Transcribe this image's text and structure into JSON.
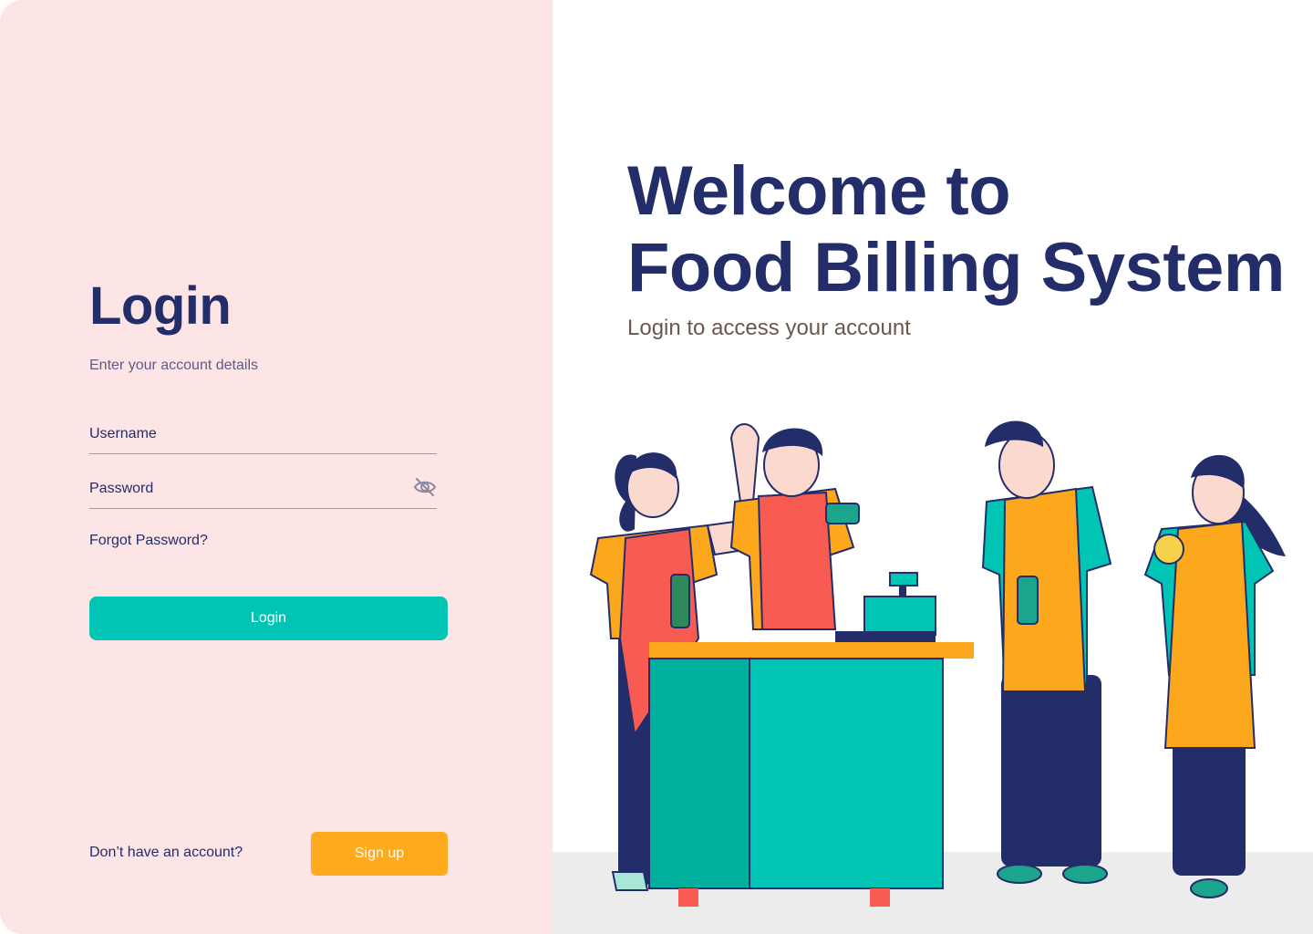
{
  "login_panel": {
    "title": "Login",
    "subtitle": "Enter your account details",
    "username_placeholder": "Username",
    "password_placeholder": "Password",
    "forgot_password": "Forgot Password?",
    "login_button": "Login",
    "signup_prompt": "Don’t have an account?",
    "signup_button": "Sign up"
  },
  "hero": {
    "title_line1": "Welcome to",
    "title_line2": "Food Billing System",
    "subtitle": "Login to access your account",
    "illustration": "cashier-staff-illustration"
  },
  "icons": {
    "password_toggle": "eye-off-icon"
  },
  "colors": {
    "left_panel_bg": "#fde4e5",
    "primary_text": "#232d69",
    "login_button": "#00c4b4",
    "signup_button": "#fdaa1d",
    "hero_subtitle": "#6b5750"
  }
}
